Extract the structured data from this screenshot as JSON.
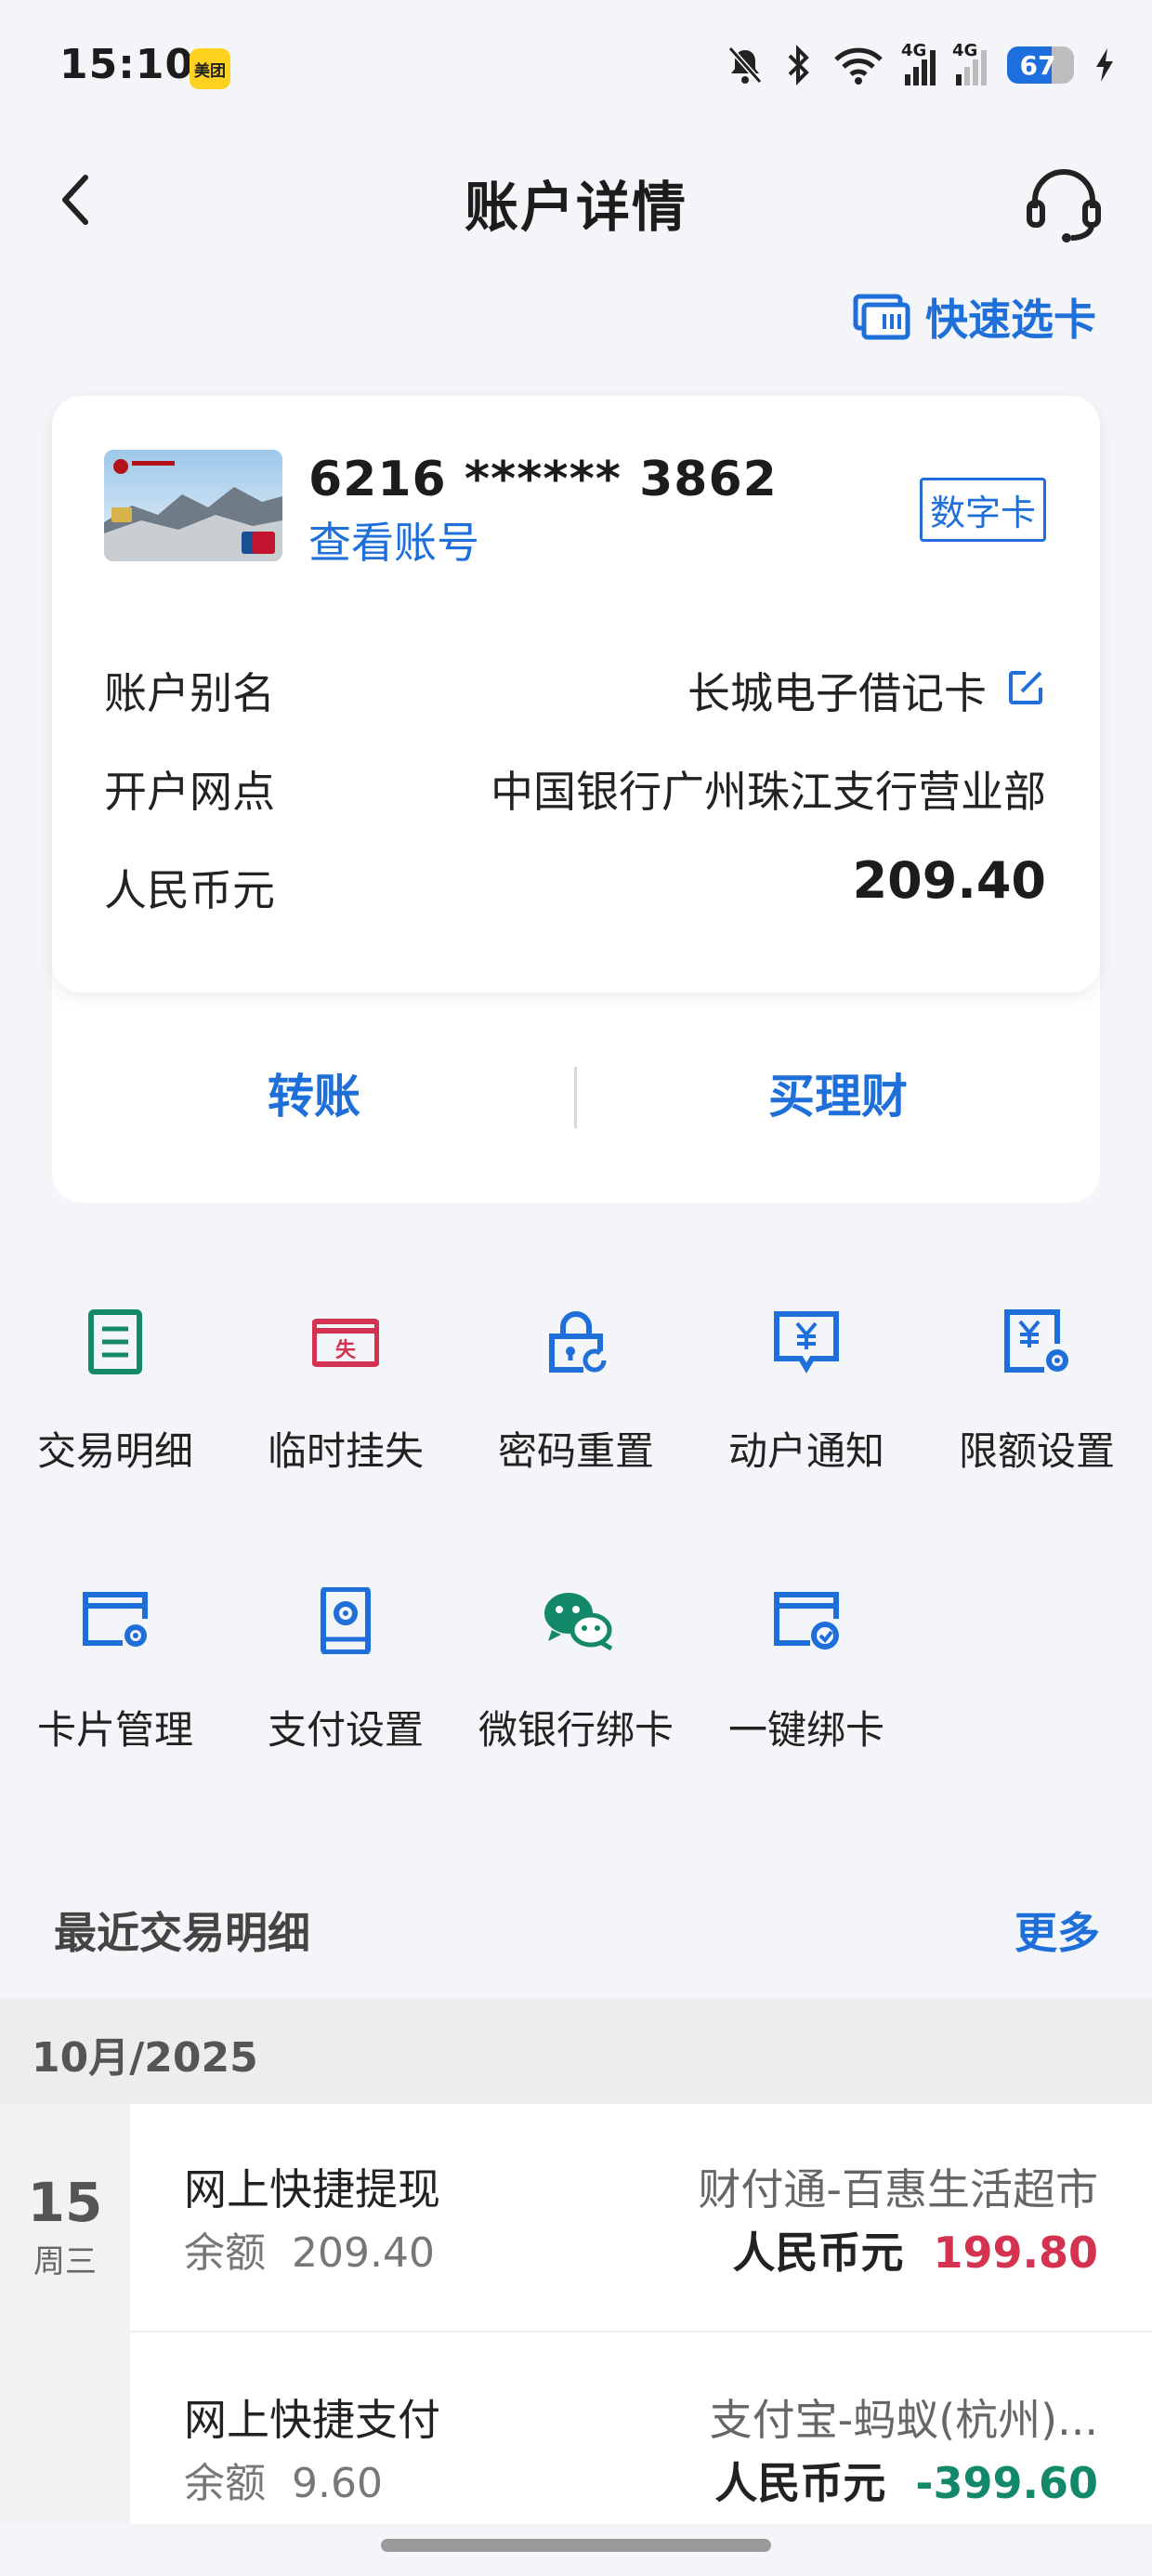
{
  "status_bar": {
    "time": "15:10",
    "app_badge": "美团",
    "network_1": "4G",
    "network_2": "4G",
    "battery_level": "67",
    "battery_fraction": 0.67
  },
  "header": {
    "title": "账户详情",
    "quick_select_label": "快速选卡"
  },
  "card": {
    "number": "6216 ****** 3862",
    "view_account_label": "查看账号",
    "badge": "数字卡",
    "rows": [
      {
        "label": "账户别名",
        "value": "长城电子借记卡"
      },
      {
        "label": "开户网点",
        "value": "中国银行广州珠江支行营业部"
      },
      {
        "label": "人民币元",
        "value": "209.40"
      }
    ],
    "actions": {
      "transfer": "转账",
      "wealth": "买理财"
    }
  },
  "services": [
    {
      "label": "交易明细",
      "icon": "list-doc-icon",
      "color": "#13896a"
    },
    {
      "label": "临时挂失",
      "icon": "report-loss-icon",
      "color": "#d33250"
    },
    {
      "label": "密码重置",
      "icon": "lock-reset-icon",
      "color": "#1e6fd9"
    },
    {
      "label": "动户通知",
      "icon": "yuan-message-icon",
      "color": "#1e6fd9"
    },
    {
      "label": "限额设置",
      "icon": "yuan-gear-icon",
      "color": "#1e6fd9"
    },
    {
      "label": "卡片管理",
      "icon": "card-gear-icon",
      "color": "#1e6fd9"
    },
    {
      "label": "支付设置",
      "icon": "phone-gear-icon",
      "color": "#1e6fd9"
    },
    {
      "label": "微银行绑卡",
      "icon": "wechat-link-icon",
      "color": "#13896a"
    },
    {
      "label": "一键绑卡",
      "icon": "card-bind-icon",
      "color": "#1e6fd9"
    }
  ],
  "recent": {
    "title": "最近交易明细",
    "more_label": "更多",
    "month": "10月/2025",
    "day": "15",
    "weekday": "周三",
    "transactions": [
      {
        "title": "网上快捷提现",
        "balance_label": "余额",
        "balance": "209.40",
        "merchant": "财付通-百惠生活超市",
        "currency": "人民币元",
        "amount": "199.80",
        "amount_color": "#d33250"
      },
      {
        "title": "网上快捷支付",
        "balance_label": "余额",
        "balance": "9.60",
        "merchant": "支付宝-蚂蚁(杭州)...",
        "currency": "人民币元",
        "amount": "-399.60",
        "amount_color": "#13896a"
      }
    ]
  }
}
